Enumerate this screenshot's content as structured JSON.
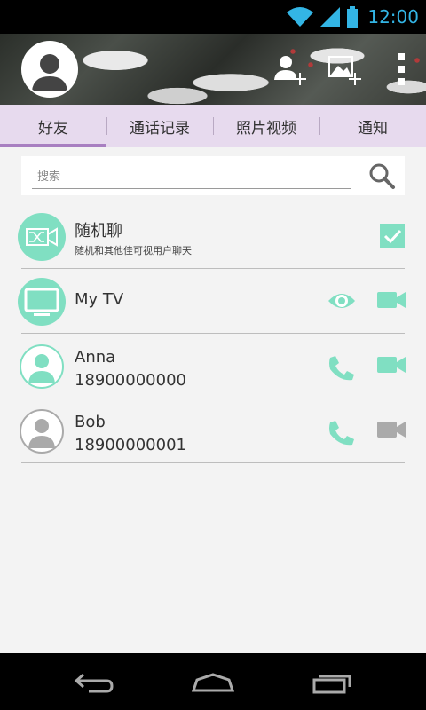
{
  "status_bar": {
    "time": "12:00",
    "accent": "#33b5e5"
  },
  "header": {
    "avatar_icon": "user-avatar-icon",
    "add_contact_icon": "add-contact-icon",
    "add_photo_icon": "add-photo-icon",
    "menu_icon": "overflow-menu-icon"
  },
  "tabs": [
    {
      "label": "好友",
      "active": true
    },
    {
      "label": "通话记录",
      "active": false
    },
    {
      "label": "照片视频",
      "active": false
    },
    {
      "label": "通知",
      "active": false
    }
  ],
  "search": {
    "placeholder": "搜索"
  },
  "contacts": [
    {
      "name": "随机聊",
      "subtitle": "随机和其他佳可视用户聊天",
      "icon": "shuffle-video-icon",
      "action": "checkbox-checked"
    },
    {
      "name": "My TV",
      "icon": "tv-icon",
      "actions": [
        "eye-icon",
        "video-call-icon"
      ]
    },
    {
      "name": "Anna",
      "phone": "18900000000",
      "status": "online",
      "actions": [
        "phone-icon",
        "video-call-icon"
      ]
    },
    {
      "name": "Bob",
      "phone": "18900000001",
      "status": "offline",
      "actions": [
        "phone-icon",
        "video-call-icon"
      ]
    }
  ],
  "colors": {
    "accent": "#80dfc2",
    "tab_bg": "#e7daee",
    "tab_indicator": "#a87fc1",
    "offline": "#aaaaaa"
  }
}
